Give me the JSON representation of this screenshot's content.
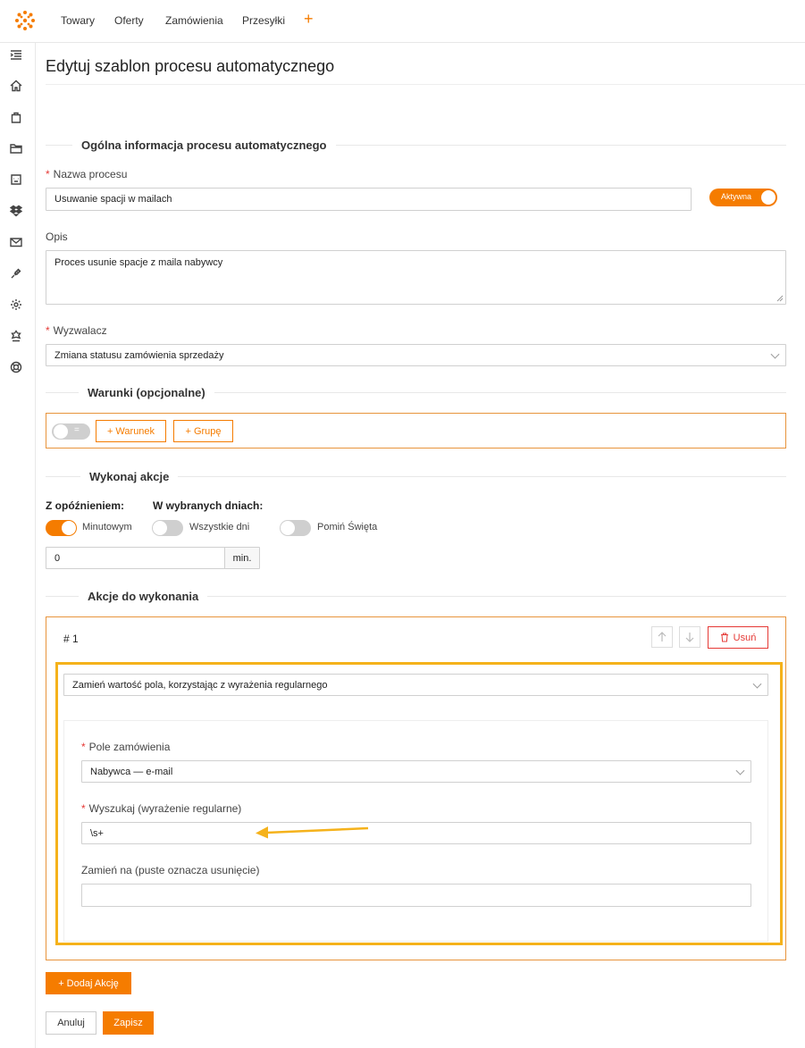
{
  "nav": {
    "items": [
      "Towary",
      "Oferty",
      "Zamówienia",
      "Przesyłki"
    ],
    "plus": "+"
  },
  "page": {
    "title": "Edytuj szablon procesu automatycznego"
  },
  "general": {
    "section_title": "Ogólna informacja procesu automatycznego",
    "name_label": "Nazwa procesu",
    "name_value": "Usuwanie spacji w mailach",
    "status_label": "Aktywna",
    "desc_label": "Opis",
    "desc_value": "Proces usunie spacje z maila nabywcy",
    "trigger_label": "Wyzwalacz",
    "trigger_value": "Zmiana statusu zamówienia sprzedaży"
  },
  "conditions": {
    "section_title": "Warunki (opcjonalne)",
    "toggle_symbol": "=",
    "add_condition": "+ Warunek",
    "add_group": "+ Grupę"
  },
  "execute": {
    "section_title": "Wykonaj akcje",
    "delay_label": "Z opóźnieniem:",
    "days_label": "W wybranych dniach:",
    "minute_label": "Minutowym",
    "all_days_label": "Wszystkie dni",
    "skip_holidays_label": "Pomiń Święta",
    "delay_value": "0",
    "delay_unit": "min."
  },
  "actions": {
    "section_title": "Akcje do wykonania",
    "item_number": "# 1",
    "delete_label": "Usuń",
    "action_type": "Zamień wartość pola, korzystając z wyrażenia regularnego",
    "field_label": "Pole zamówienia",
    "field_value": "Nabywca — e-mail",
    "search_label": "Wyszukaj (wyrażenie regularne)",
    "search_value": "\\s+",
    "replace_label": "Zamień na (puste oznacza usunięcie)",
    "replace_value": ""
  },
  "footer": {
    "add_action": "+ Dodaj Akcję",
    "cancel": "Anuluj",
    "save": "Zapisz"
  },
  "colors": {
    "accent": "#f57c00",
    "highlight": "#f5b21b",
    "toggle_off": "#cfcfcf",
    "danger": "#e53935"
  },
  "icons": [
    "logo-icon",
    "menu-collapse-icon",
    "home-icon",
    "bag-icon",
    "folder-icon",
    "inbox-icon",
    "dropbox-icon",
    "mail-icon",
    "plug-icon",
    "settings-icon",
    "badge-icon",
    "lifebuoy-icon",
    "arrow-up-icon",
    "arrow-down-icon",
    "trash-icon"
  ]
}
